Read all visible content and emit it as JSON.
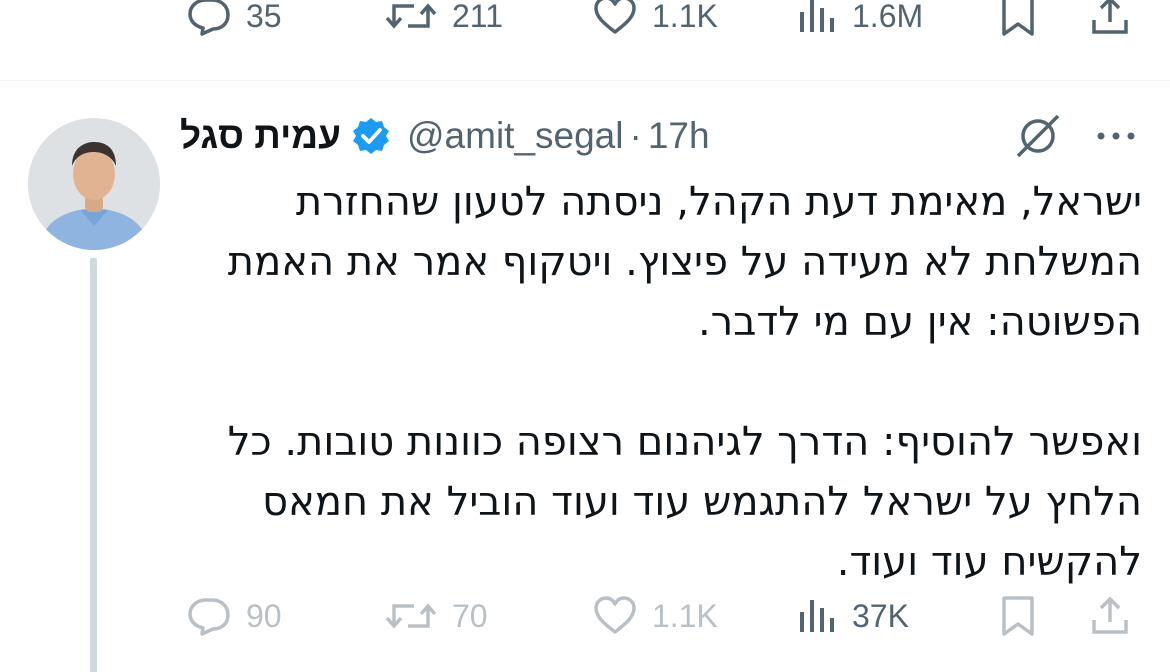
{
  "previous_tweet": {
    "actions": {
      "replies": "35",
      "retweets": "211",
      "likes": "1.1K",
      "views": "1.6M"
    }
  },
  "tweet": {
    "author_name": "עמית סגל",
    "verified": true,
    "handle": "@amit_segal",
    "separator": "·",
    "time": "17h",
    "text_lines": [
      "ישראל, מאימת דעת הקהל, ניסתה לטעון שהחזרת",
      "המשלחת לא מעידה על פיצוץ. ויטקוף אמר את האמת",
      "הפשוטה: אין עם מי לדבר.",
      "",
      "ואפשר להוסיף: הדרך לגיהנום רצופה כוונות טובות. כל",
      "הלחץ על ישראל להתגמש עוד ועוד הוביל את חמאס",
      "להקשיח עוד ועוד."
    ],
    "actions": {
      "replies": "90",
      "retweets": "70",
      "likes": "1.1K",
      "views": "37K"
    }
  },
  "icons": {
    "reply": "speech-bubble-icon",
    "retweet": "retweet-arrows-icon",
    "like": "heart-icon",
    "views": "bar-chart-icon",
    "bookmark": "bookmark-icon",
    "share": "share-upload-icon",
    "verified": "verified-badge-icon",
    "grok": "grok-icon",
    "more": "more-dots-icon"
  },
  "colors": {
    "verified_blue": "#1d9bf0",
    "muted_gray": "#536471",
    "faded_gray": "#b9c0c6",
    "thread_line": "#cfd9de"
  }
}
